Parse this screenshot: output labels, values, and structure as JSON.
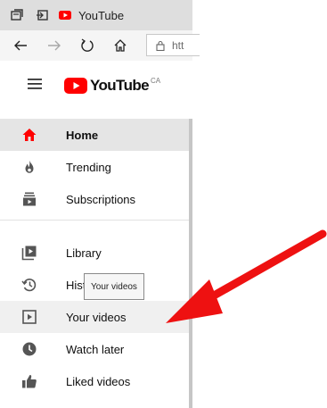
{
  "browser": {
    "tab_title": "YouTube",
    "address_text": "htt"
  },
  "youtube": {
    "logo_text": "YouTube",
    "country_code": "CA"
  },
  "sidebar": {
    "items": [
      {
        "label": "Home",
        "icon": "home-icon",
        "active": true
      },
      {
        "label": "Trending",
        "icon": "flame-icon"
      },
      {
        "label": "Subscriptions",
        "icon": "subscriptions-icon"
      },
      {
        "label": "Library",
        "icon": "library-icon"
      },
      {
        "label": "Hist",
        "icon": "history-icon"
      },
      {
        "label": "Your videos",
        "icon": "play-square-icon",
        "hovered": true
      },
      {
        "label": "Watch later",
        "icon": "clock-icon"
      },
      {
        "label": "Liked videos",
        "icon": "thumbs-up-icon"
      }
    ]
  },
  "tooltip": {
    "text": "Your videos"
  },
  "colors": {
    "youtube_red": "#ff0000",
    "arrow_red": "#ee1111",
    "active_bg": "#e5e5e5"
  }
}
